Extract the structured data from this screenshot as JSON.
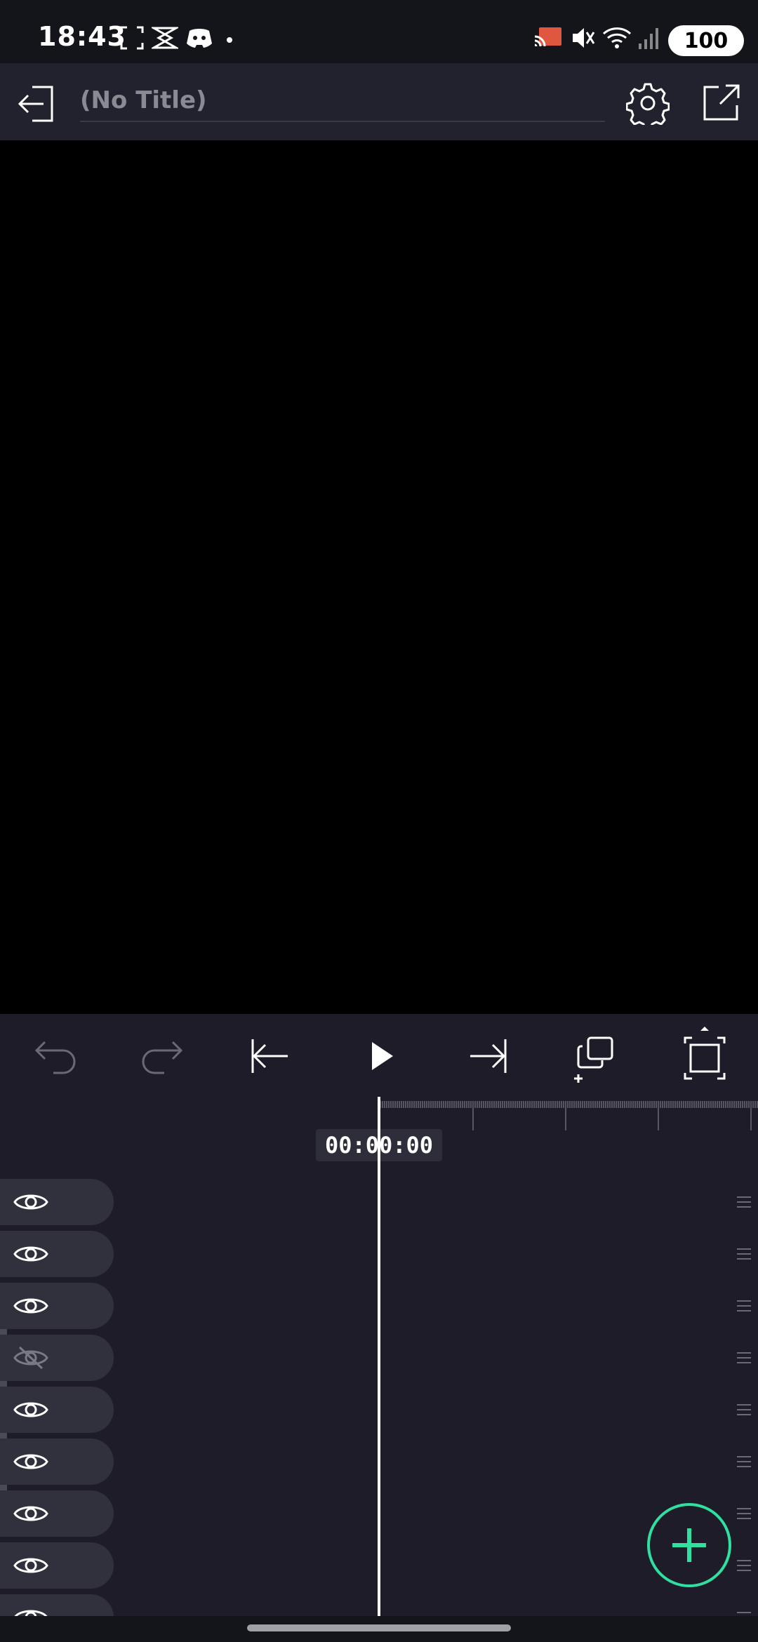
{
  "status_bar": {
    "time": "18:43",
    "battery": "100"
  },
  "header": {
    "title_placeholder": "(No Title)"
  },
  "timeline": {
    "timecode": "00:00:00",
    "tracks": [
      {
        "visible": true
      },
      {
        "visible": true
      },
      {
        "visible": true
      },
      {
        "visible": false
      },
      {
        "visible": true
      },
      {
        "visible": true
      },
      {
        "visible": true
      },
      {
        "visible": true
      },
      {
        "visible": true
      }
    ]
  },
  "colors": {
    "accent": "#2fe0a0",
    "background": "#1d1c28",
    "preview": "#000000",
    "track_header": "#31313e"
  }
}
